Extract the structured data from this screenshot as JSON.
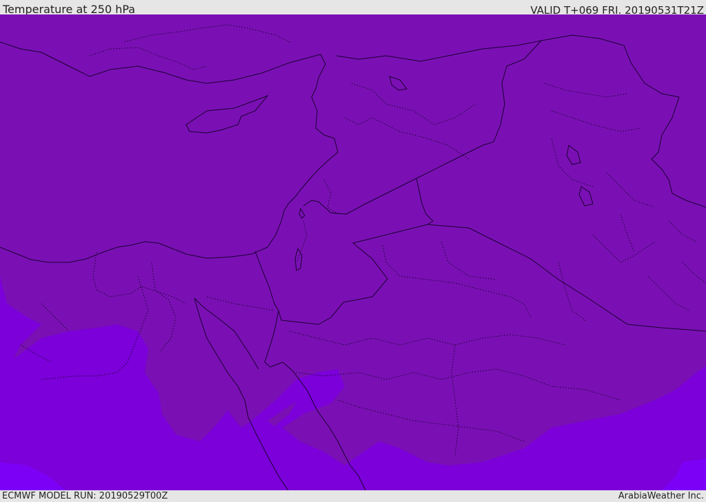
{
  "header": {
    "title": "Temperature at 250 hPa",
    "valid": "VALID T+069 FRI. 20190531T21Z"
  },
  "footer": {
    "model_run": "ECMWF MODEL RUN: 20190529T00Z",
    "credit": "ArabiaWeather Inc."
  },
  "map": {
    "field": "Temperature at 250 hPa",
    "fill_colors": {
      "dominant": "#7a10b4",
      "secondary": "#7b00d9",
      "tertiary": "#7d00f6"
    },
    "boundary_color": "#1a0030"
  }
}
